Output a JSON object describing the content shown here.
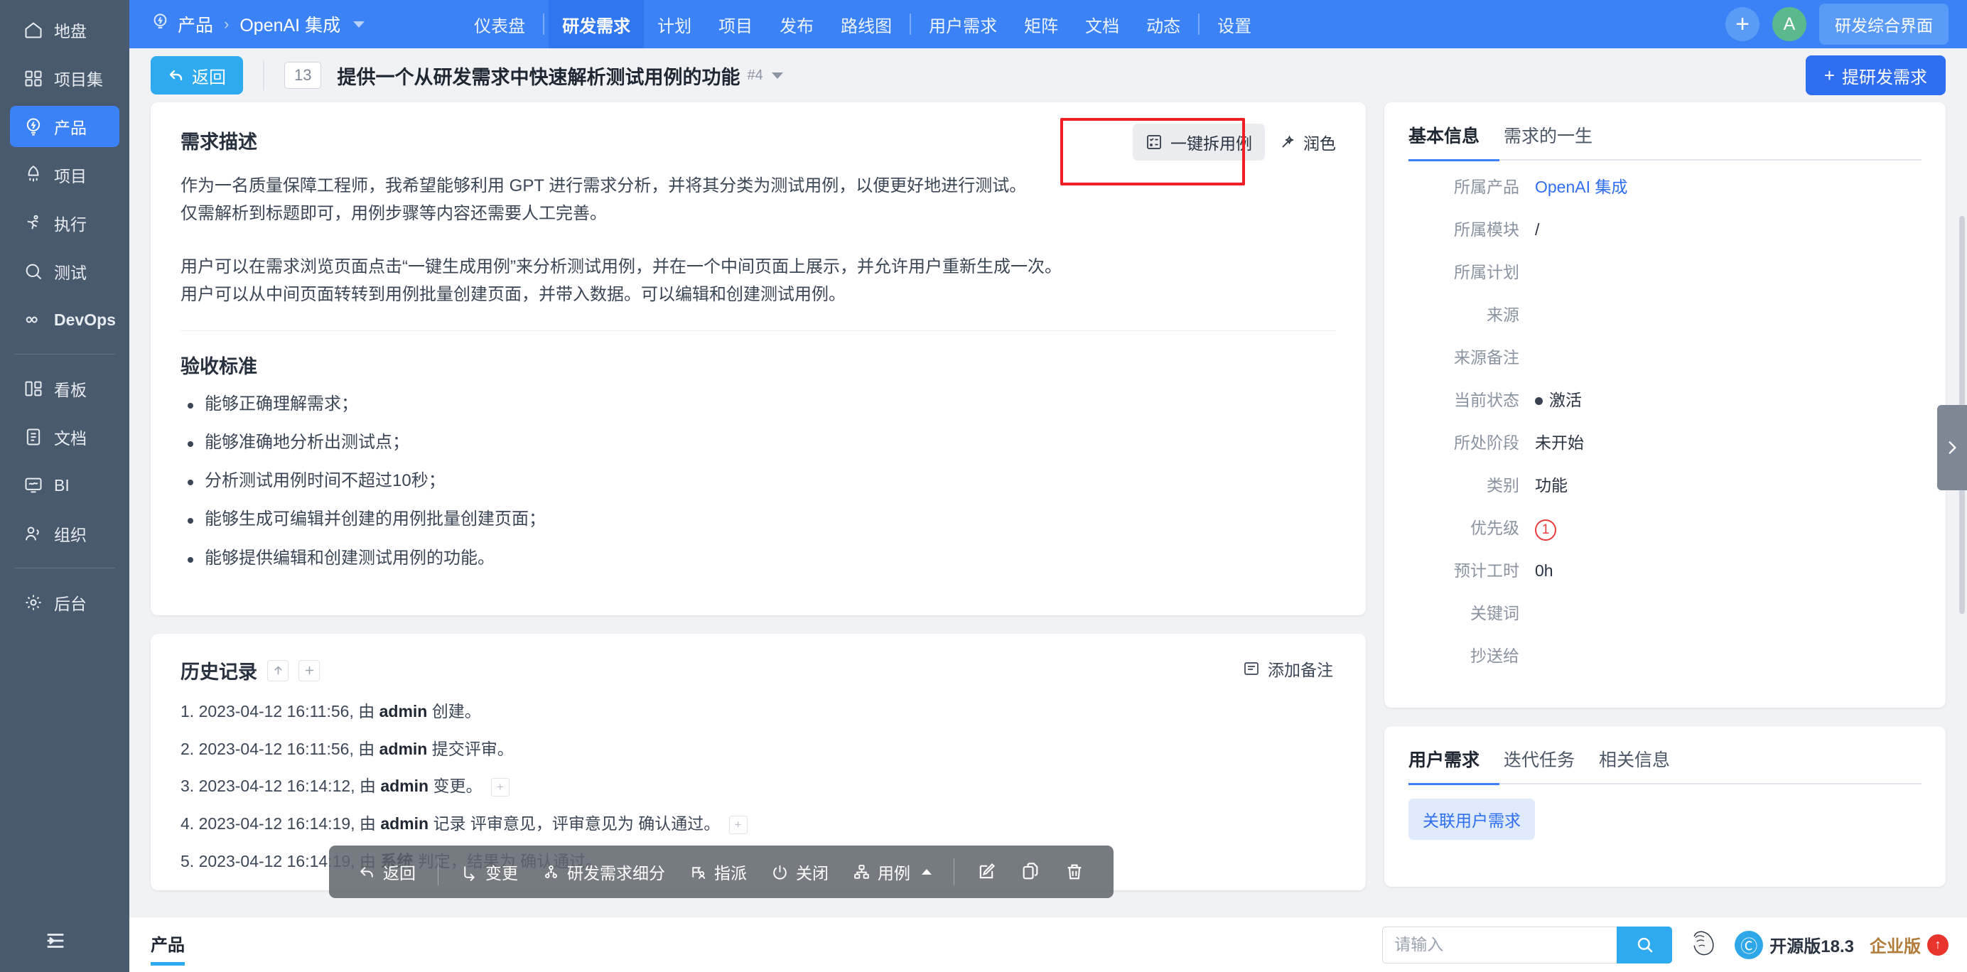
{
  "sidebar": {
    "groups": [
      {
        "items": [
          {
            "label": "地盘",
            "icon": "home-icon",
            "active": false
          },
          {
            "label": "项目集",
            "icon": "program-icon",
            "active": false
          },
          {
            "label": "产品",
            "icon": "bulb-icon",
            "active": true
          },
          {
            "label": "项目",
            "icon": "rocket-icon",
            "active": false
          },
          {
            "label": "执行",
            "icon": "runner-icon",
            "active": false
          },
          {
            "label": "测试",
            "icon": "magnifier-icon",
            "active": false
          },
          {
            "label": "DevOps",
            "icon": "infinity-icon",
            "active": false
          }
        ]
      },
      {
        "items": [
          {
            "label": "看板",
            "icon": "kanban-icon",
            "active": false
          },
          {
            "label": "文档",
            "icon": "doc-icon",
            "active": false
          },
          {
            "label": "BI",
            "icon": "monitor-icon",
            "active": false
          },
          {
            "label": "组织",
            "icon": "people-icon",
            "active": false
          }
        ]
      },
      {
        "items": [
          {
            "label": "后台",
            "icon": "gear-icon",
            "active": false
          }
        ]
      }
    ],
    "collapse_label": "收起菜单"
  },
  "topnav": {
    "breadcrumb_root": "产品",
    "breadcrumb_current": "OpenAI 集成",
    "tabs": [
      {
        "label": "仪表盘",
        "active": false,
        "sep_after": true
      },
      {
        "label": "研发需求",
        "active": true,
        "sep_after": false
      },
      {
        "label": "计划",
        "active": false,
        "sep_after": false
      },
      {
        "label": "项目",
        "active": false,
        "sep_after": false
      },
      {
        "label": "发布",
        "active": false,
        "sep_after": false
      },
      {
        "label": "路线图",
        "active": false,
        "sep_after": true
      },
      {
        "label": "用户需求",
        "active": false,
        "sep_after": false
      },
      {
        "label": "矩阵",
        "active": false,
        "sep_after": false
      },
      {
        "label": "文档",
        "active": false,
        "sep_after": false
      },
      {
        "label": "动态",
        "active": false,
        "sep_after": true
      },
      {
        "label": "设置",
        "active": false,
        "sep_after": false
      }
    ],
    "add_label": "+",
    "avatar_letter": "A",
    "pill_label": "研发综合界面"
  },
  "subbar": {
    "back_label": "返回",
    "story_id": "13",
    "story_title": "提供一个从研发需求中快速解析测试用例的功能",
    "story_version": "#4",
    "create_label": "提研发需求"
  },
  "description": {
    "heading": "需求描述",
    "paragraphs": [
      "作为一名质量保障工程师，我希望能够利用 GPT 进行需求分析，并将其分类为测试用例，以便更好地进行测试。",
      "仅需解析到标题即可，用例步骤等内容还需要人工完善。",
      "用户可以在需求浏览页面点击“一键生成用例”来分析测试用例，并在一个中间页面上展示，并允许用户重新生成一次。",
      "用户可以从中间页面转转到用例批量创建页面，并带入数据。可以编辑和创建测试用例。"
    ],
    "ai_split_label": "一键拆用例",
    "ai_polish_label": "润色"
  },
  "criteria": {
    "heading": "验收标准",
    "items": [
      "能够正确理解需求；",
      "能够准确地分析出测试点；",
      "分析测试用例时间不超过10秒；",
      "能够生成可编辑并创建的用例批量创建页面；",
      "能够提供编辑和创建测试用例的功能。"
    ]
  },
  "history": {
    "heading": "历史记录",
    "add_note_label": "添加备注",
    "entries": [
      {
        "index": "1.",
        "time": "2023-04-12 16:11:56, 由 ",
        "actor": "admin",
        "action": " 创建。",
        "has_plus": false
      },
      {
        "index": "2.",
        "time": "2023-04-12 16:11:56, 由 ",
        "actor": "admin",
        "action": " 提交评审。",
        "has_plus": false
      },
      {
        "index": "3.",
        "time": "2023-04-12 16:14:12, 由 ",
        "actor": "admin",
        "action": " 变更。",
        "has_plus": true
      },
      {
        "index": "4.",
        "time": "2023-04-12 16:14:19, 由 ",
        "actor": "admin",
        "action": " 记录 评审意见，评审意见为 确认通过。",
        "has_plus": true
      },
      {
        "index": "5.",
        "time": "2023-04-12 16:14:19, 由 ",
        "actor": "系统",
        "action": " 判定，结果为 确认通过。",
        "has_plus": false
      }
    ]
  },
  "info_panel": {
    "tabs": [
      {
        "label": "基本信息",
        "active": true
      },
      {
        "label": "需求的一生",
        "active": false
      }
    ],
    "fields": [
      {
        "label": "所属产品",
        "value": "OpenAI 集成",
        "type": "link"
      },
      {
        "label": "所属模块",
        "value": "/",
        "type": "text"
      },
      {
        "label": "所属计划",
        "value": "",
        "type": "text"
      },
      {
        "label": "来源",
        "value": "",
        "type": "text"
      },
      {
        "label": "来源备注",
        "value": "",
        "type": "text"
      },
      {
        "label": "当前状态",
        "value": "激活",
        "type": "dot"
      },
      {
        "label": "所处阶段",
        "value": "未开始",
        "type": "text"
      },
      {
        "label": "类别",
        "value": "功能",
        "type": "text"
      },
      {
        "label": "优先级",
        "value": "1",
        "type": "priority"
      },
      {
        "label": "预计工时",
        "value": "0h",
        "type": "text"
      },
      {
        "label": "关键词",
        "value": "",
        "type": "text"
      },
      {
        "label": "抄送给",
        "value": "",
        "type": "text"
      }
    ]
  },
  "relation_panel": {
    "tabs": [
      {
        "label": "用户需求",
        "active": true
      },
      {
        "label": "迭代任务",
        "active": false
      },
      {
        "label": "相关信息",
        "active": false
      }
    ],
    "chip_label": "关联用户需求"
  },
  "floatbar": {
    "items": [
      {
        "label": "返回",
        "icon": "back-arrow-icon",
        "caret": false,
        "sep_after": true
      },
      {
        "label": "变更",
        "icon": "change-icon",
        "caret": false,
        "sep_after": false
      },
      {
        "label": "研发需求细分",
        "icon": "split-icon",
        "caret": false,
        "sep_after": false
      },
      {
        "label": "指派",
        "icon": "assign-icon",
        "caret": false,
        "sep_after": false
      },
      {
        "label": "关闭",
        "icon": "power-icon",
        "caret": false,
        "sep_after": false
      },
      {
        "label": "用例",
        "icon": "case-icon",
        "caret": true,
        "sep_after": true
      }
    ],
    "icon_buttons": [
      {
        "icon": "edit-icon"
      },
      {
        "icon": "copy-icon"
      },
      {
        "icon": "trash-icon"
      }
    ]
  },
  "footer": {
    "tab_label": "产品",
    "search_placeholder": "请输入",
    "search_value": "",
    "version_label": "开源版18.3",
    "enterprise_label": "企业版"
  },
  "colors": {
    "brand_blue": "#3b82f6",
    "sidebar_bg": "#495a6e",
    "accent_cyan": "#2eaaf0",
    "highlight_red": "#ee1f24",
    "priority_red": "#ec3b3b",
    "link_blue": "#2f6ef0",
    "enterprise_gold": "#b07c3a"
  }
}
